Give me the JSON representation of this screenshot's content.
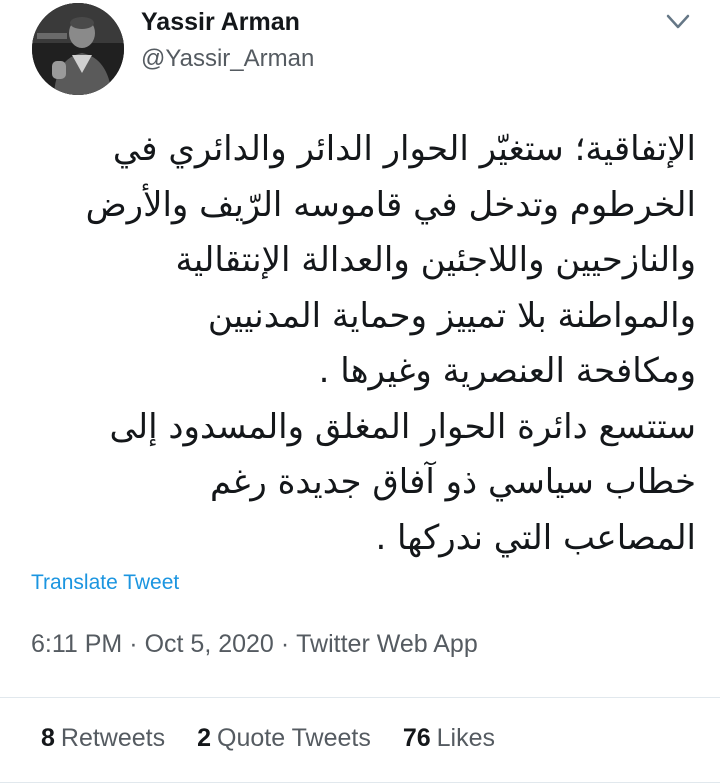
{
  "user": {
    "display_name": "Yassir Arman",
    "handle": "@Yassir_Arman"
  },
  "tweet": {
    "lines": [
      "الإتفاقية؛ ستغيّر الحوار الدائر والدائري في",
      "الخرطوم وتدخل في قاموسه الرّيف والأرض",
      "والنازحيين واللاجئين والعدالة الإنتقالية",
      "والمواطنة بلا تمييز  وحماية المدنيين",
      "ومكافحة العنصرية وغيرها .",
      "ستتسع دائرة الحوار المغلق والمسدود إلى",
      "خطاب سياسي ذو آفاق جديدة رغم",
      "المصاعب التي ندركها ."
    ],
    "translate_label": "Translate Tweet",
    "time": "6:11 PM",
    "date": "Oct 5, 2020",
    "source": "Twitter Web App",
    "separator": "·"
  },
  "stats": {
    "retweets_count": "8",
    "retweets_label": "Retweets",
    "quote_tweets_count": "2",
    "quote_tweets_label": "Quote Tweets",
    "likes_count": "76",
    "likes_label": "Likes"
  },
  "colors": {
    "link": "#1b95e0",
    "secondary_text": "#555b61",
    "primary_text": "#14171a",
    "divider": "#e1e8ed"
  },
  "icons": {
    "avatar": "profile-photo",
    "menu": "chevron-down-icon"
  }
}
